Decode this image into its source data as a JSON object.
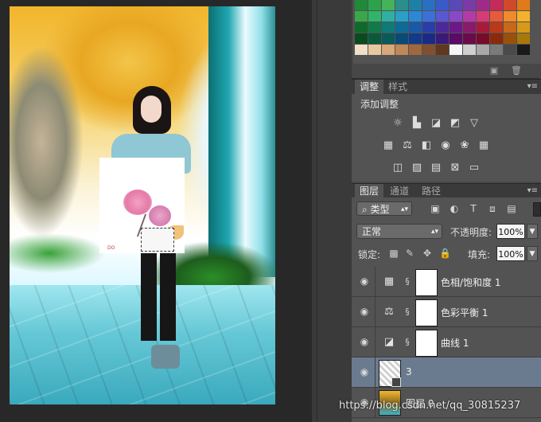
{
  "document": {
    "overlay_mark": "DO"
  },
  "swatches": {
    "colors": [
      "#1e8a3a",
      "#2aa34a",
      "#44b35a",
      "#2a8f8a",
      "#1e7fa8",
      "#2a6fc1",
      "#3a5ac8",
      "#5a48b8",
      "#7a3aa8",
      "#a02a8a",
      "#c42a5a",
      "#d04a2a",
      "#e07a1a",
      "#3aa84a",
      "#2fb46a",
      "#2fb0a0",
      "#2aa0c8",
      "#2a88d6",
      "#3a70d8",
      "#5a58d0",
      "#8a48c8",
      "#b43aa8",
      "#d83a78",
      "#e85a3a",
      "#f08a2a",
      "#f4b22a",
      "#0f6a2a",
      "#127a4a",
      "#0f7a78",
      "#0f6a98",
      "#1a58a8",
      "#283ea8",
      "#4a2a98",
      "#6a1a88",
      "#8a1a6a",
      "#a81a3a",
      "#b83a1a",
      "#c8681a",
      "#d8981a",
      "#0a4a1e",
      "#0a5a3a",
      "#0a5a5a",
      "#0a4a78",
      "#123a88",
      "#1a2a88",
      "#3a1a78",
      "#5a0a68",
      "#6a0a4a",
      "#7a0a2a",
      "#8a2a0a",
      "#9a500a",
      "#a8780a",
      "#f0e0c8",
      "#e8c8a0",
      "#d8a878",
      "#c08858",
      "#a06840",
      "#805030",
      "#603820",
      "#f6f6f6",
      "#cfcfcf",
      "#a8a8a8",
      "#7a7a7a",
      "#4a4a4a",
      "#1a1a1a"
    ]
  },
  "adjustments_panel": {
    "tabs": [
      "调整",
      "样式"
    ],
    "title": "添加调整",
    "icons_row1": [
      "brightness-icon",
      "levels-icon",
      "curves-icon",
      "exposure-icon",
      "vibrance-icon"
    ],
    "icons_row2": [
      "hue-saturation-icon",
      "color-balance-icon",
      "black-white-icon",
      "photo-filter-icon",
      "channel-mixer-icon",
      "color-lookup-icon"
    ],
    "icons_row3": [
      "invert-icon",
      "posterize-icon",
      "threshold-icon",
      "selective-color-icon",
      "gradient-map-icon"
    ]
  },
  "layers_panel": {
    "tabs": [
      "图层",
      "通道",
      "路径"
    ],
    "filter_kind": "类型",
    "blend_mode": "正常",
    "opacity_label": "不透明度:",
    "opacity_value": "100%",
    "lock_label": "锁定:",
    "fill_label": "填充:",
    "fill_value": "100%",
    "layers": [
      {
        "name": "色相/饱和度 1",
        "type": "adjustment",
        "selected": false
      },
      {
        "name": "色彩平衡 1",
        "type": "adjustment",
        "selected": false
      },
      {
        "name": "曲线 1",
        "type": "adjustment",
        "selected": false
      },
      {
        "name": "3",
        "type": "smart-object",
        "selected": true
      },
      {
        "name": "图层 0",
        "type": "image",
        "selected": false
      }
    ]
  },
  "watermark": "https://blog.csdn.net/qq_30815237"
}
